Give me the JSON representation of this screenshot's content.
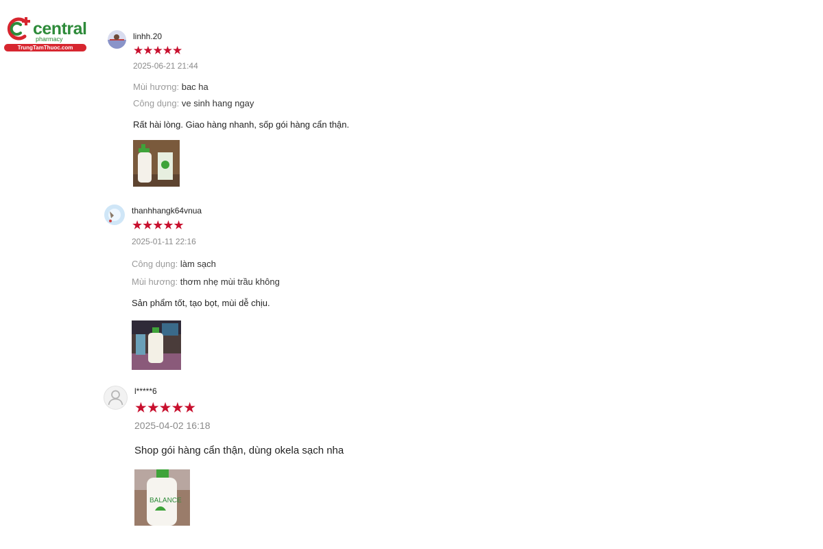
{
  "brand": {
    "name": "central",
    "sub": "pharmacy",
    "domain": "TrungTamThuoc.com",
    "colors": {
      "green": "#2e8b3a",
      "red": "#d7262f"
    }
  },
  "reviews": [
    {
      "username": "linhh.20",
      "stars": 5,
      "star_glyph": "★★★★★",
      "date": "2025-06-21 21:44",
      "attributes": [
        {
          "key": "Mùi hương:",
          "value": "bac ha"
        },
        {
          "key": "Công dụng:",
          "value": "ve sinh hang ngay"
        }
      ],
      "comment": "Rất hài lòng. Giao hàng nhanh, sốp gói hàng cẩn thận."
    },
    {
      "username": "thanhhangk64vnua",
      "stars": 5,
      "star_glyph": "★★★★★",
      "date": "2025-01-11 22:16",
      "attributes": [
        {
          "key": "Công dụng:",
          "value": "làm sạch"
        },
        {
          "key": "Mùi hương:",
          "value": "thơm nhẹ mùi trầu không"
        }
      ],
      "comment": "Sản phẩm tốt, tạo bọt, mùi dễ chịu."
    },
    {
      "username": "l*****6",
      "stars": 5,
      "star_glyph": "★★★★★",
      "date": "2025-04-02 16:18",
      "attributes": [],
      "comment": "Shop gói hàng cẩn thận, dùng okela sạch nha",
      "photo_text": "BALANCE"
    }
  ],
  "star_color": "#c8102e"
}
